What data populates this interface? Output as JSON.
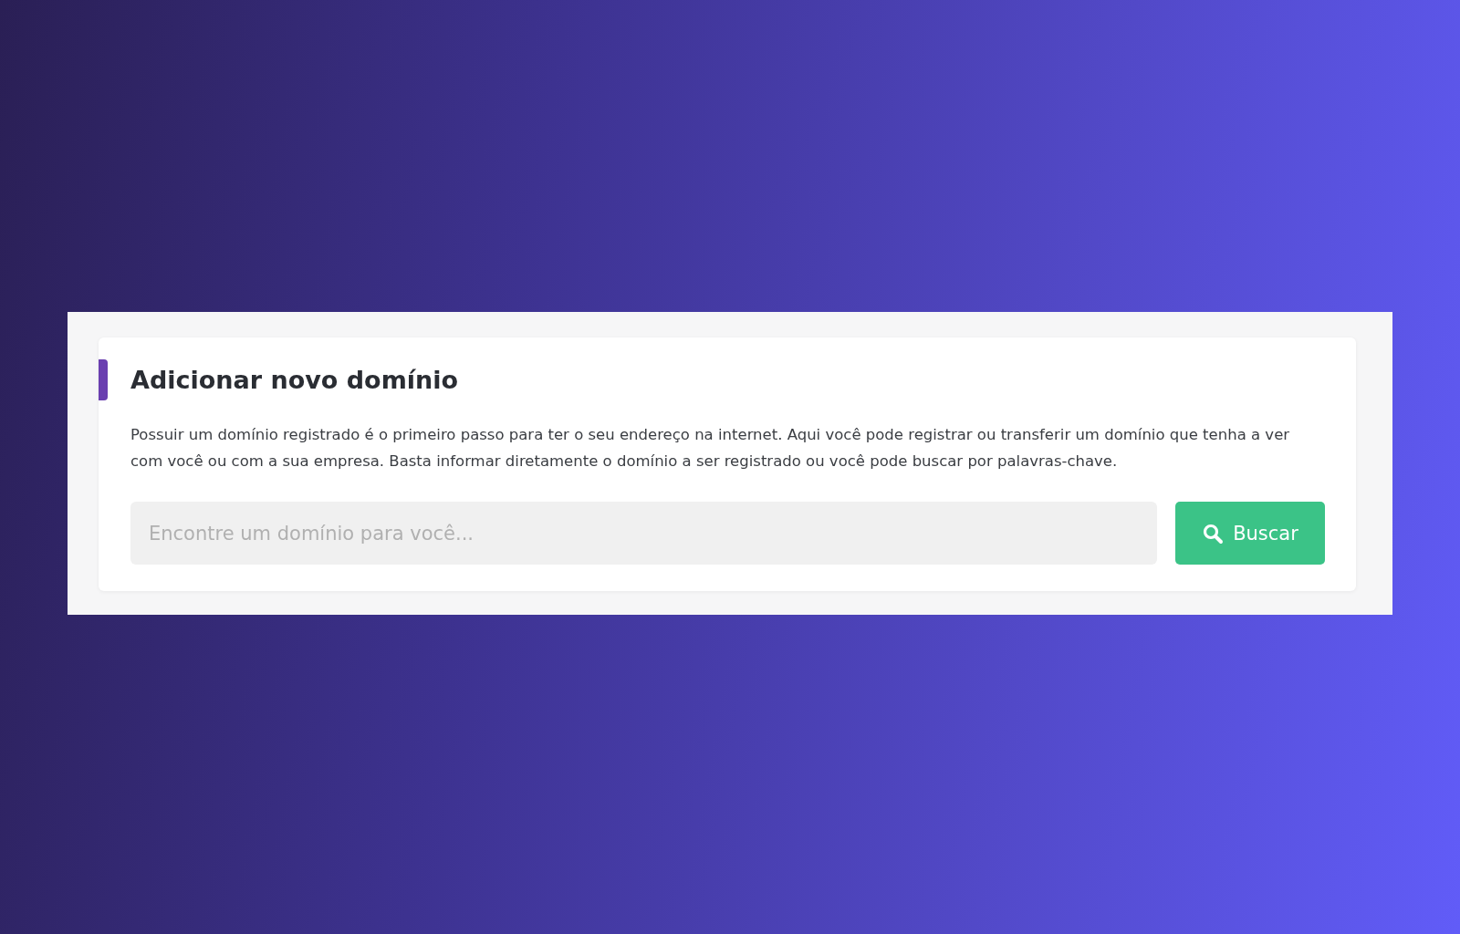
{
  "card": {
    "title": "Adicionar novo domínio",
    "description": "Possuir um domínio registrado é o primeiro passo para ter o seu endereço na internet. Aqui você pode registrar ou transferir um domínio que tenha a ver com você ou com a sua empresa. Basta informar diretamente o domínio a ser registrado ou você pode buscar por palavras-chave.",
    "search": {
      "placeholder": "Encontre um domínio para você..."
    },
    "button": "Buscar"
  }
}
